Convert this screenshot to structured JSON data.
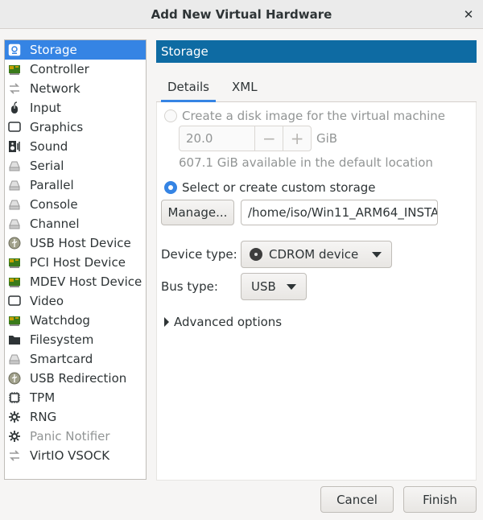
{
  "window": {
    "title": "Add New Virtual Hardware",
    "close": "✕"
  },
  "sidebar": {
    "items": [
      {
        "label": "Storage",
        "icon": "disk-icon",
        "selected": true
      },
      {
        "label": "Controller",
        "icon": "chip-icon"
      },
      {
        "label": "Network",
        "icon": "network-icon"
      },
      {
        "label": "Input",
        "icon": "mouse-icon"
      },
      {
        "label": "Graphics",
        "icon": "monitor-icon"
      },
      {
        "label": "Sound",
        "icon": "speaker-icon"
      },
      {
        "label": "Serial",
        "icon": "drive-icon"
      },
      {
        "label": "Parallel",
        "icon": "drive-icon"
      },
      {
        "label": "Console",
        "icon": "drive-icon"
      },
      {
        "label": "Channel",
        "icon": "drive-icon"
      },
      {
        "label": "USB Host Device",
        "icon": "usb-icon"
      },
      {
        "label": "PCI Host Device",
        "icon": "chip-icon"
      },
      {
        "label": "MDEV Host Device",
        "icon": "chip-icon"
      },
      {
        "label": "Video",
        "icon": "monitor-icon"
      },
      {
        "label": "Watchdog",
        "icon": "chip-icon"
      },
      {
        "label": "Filesystem",
        "icon": "folder-icon"
      },
      {
        "label": "Smartcard",
        "icon": "drive-icon"
      },
      {
        "label": "USB Redirection",
        "icon": "usb-icon"
      },
      {
        "label": "TPM",
        "icon": "cpu-icon"
      },
      {
        "label": "RNG",
        "icon": "gear-icon"
      },
      {
        "label": "Panic Notifier",
        "icon": "gear-icon",
        "disabled": true
      },
      {
        "label": "VirtIO VSOCK",
        "icon": "network-icon"
      }
    ]
  },
  "header": {
    "title": "Storage"
  },
  "tabs": [
    {
      "label": "Details",
      "active": true
    },
    {
      "label": "XML"
    }
  ],
  "storage": {
    "create_label": "Create a disk image for the virtual machine",
    "size_value": "20.0",
    "minus": "−",
    "plus": "+",
    "unit": "GiB",
    "available": "607.1 GiB available in the default location",
    "custom_label": "Select or create custom storage",
    "manage_label": "Manage...",
    "path_value": "/home/iso/Win11_ARM64_INSTA"
  },
  "device": {
    "device_type_label": "Device type:",
    "device_type_value": "CDROM device",
    "bus_type_label": "Bus type:",
    "bus_type_value": "USB",
    "advanced_label": "Advanced options"
  },
  "footer": {
    "cancel_label": "Cancel",
    "finish_label": "Finish"
  },
  "colors": {
    "accent": "#3584e4",
    "header": "#0e6ba3"
  }
}
